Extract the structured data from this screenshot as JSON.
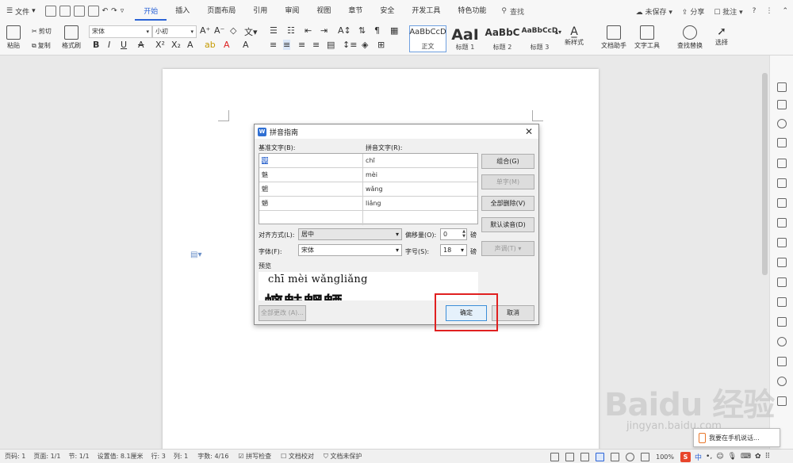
{
  "menubar": {
    "file_label": "文件",
    "tabs": [
      {
        "label": "开始",
        "active": true
      },
      {
        "label": "插入"
      },
      {
        "label": "页面布局"
      },
      {
        "label": "引用"
      },
      {
        "label": "审阅"
      },
      {
        "label": "视图"
      },
      {
        "label": "章节"
      },
      {
        "label": "安全"
      },
      {
        "label": "开发工具"
      },
      {
        "label": "特色功能"
      }
    ],
    "search_label": "查找",
    "unsaved": "未保存",
    "share": "分享",
    "comment": "批注",
    "help": "?"
  },
  "ribbon": {
    "paste": "粘贴",
    "cut": "剪切",
    "copy": "复制",
    "format_painter": "格式刷",
    "font_name": "宋体",
    "font_size": "小初",
    "bold": "B",
    "italic": "I",
    "underline": "U",
    "styles": [
      {
        "sample": "AaBbCcD",
        "name": "正文"
      },
      {
        "sample": "AaI",
        "name": "标题 1"
      },
      {
        "sample": "AaBbC",
        "name": "标题 2"
      },
      {
        "sample": "AaBbCcD",
        "name": "标题 3"
      }
    ],
    "new_style": "新样式",
    "doc_helper": "文档助手",
    "text_tools": "文字工具",
    "find_replace": "查找替换",
    "select": "选择"
  },
  "dialog": {
    "title": "拼音指南",
    "base_text_label": "基准文字(B):",
    "ruby_text_label": "拼音文字(R):",
    "rows": [
      {
        "base": "螭",
        "ruby": "chī"
      },
      {
        "base": "魅",
        "ruby": "mèi"
      },
      {
        "base": "魍",
        "ruby": "wǎng"
      },
      {
        "base": "魉",
        "ruby": "liǎng"
      },
      {
        "base": "",
        "ruby": ""
      }
    ],
    "buttons": {
      "group": "组合(G)",
      "mono": "单字(M)",
      "clear_all": "全部删除(V)",
      "default_reading": "默认读音(D)",
      "tone": "声调(T)",
      "apply_all": "全部更改 (A)...",
      "ok": "确定",
      "cancel": "取消"
    },
    "alignment_label": "对齐方式(L):",
    "alignment_value": "居中",
    "offset_label": "偏移量(O):",
    "offset_value": "0",
    "offset_unit": "磅",
    "font_label": "字体(F):",
    "font_value": "宋体",
    "size_label": "字号(S):",
    "size_value": "18",
    "size_unit": "磅",
    "preview_label": "预览",
    "preview_pinyin": "chī mèi wǎngliǎng",
    "preview_hanzi": "螭魅魍魉"
  },
  "status": {
    "page_no": "页码: 1",
    "pages": "页面: 1/1",
    "section": "节: 1/1",
    "position": "设置值: 8.1厘米",
    "row": "行: 3",
    "col": "列: 1",
    "words": "字数: 4/16",
    "spell": "拼写检查",
    "proof": "文档校对",
    "protect": "文档未保护",
    "zoom": "100%"
  },
  "overlay": {
    "phone_tip": "我要在手机说话...",
    "ime_mode": "中",
    "watermark": "Baidu 经验",
    "watermark_url": "jingyan.baidu.com"
  }
}
